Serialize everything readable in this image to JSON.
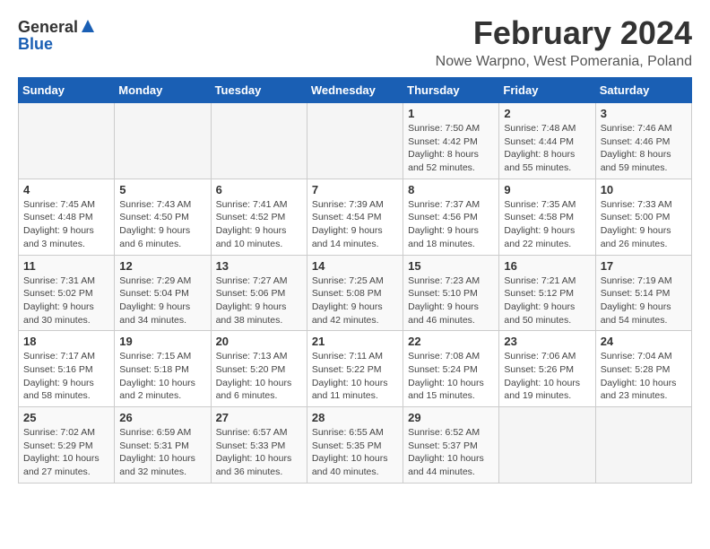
{
  "logo": {
    "general": "General",
    "blue": "Blue"
  },
  "title": "February 2024",
  "subtitle": "Nowe Warpno, West Pomerania, Poland",
  "days_of_week": [
    "Sunday",
    "Monday",
    "Tuesday",
    "Wednesday",
    "Thursday",
    "Friday",
    "Saturday"
  ],
  "weeks": [
    [
      {
        "day": "",
        "info": ""
      },
      {
        "day": "",
        "info": ""
      },
      {
        "day": "",
        "info": ""
      },
      {
        "day": "",
        "info": ""
      },
      {
        "day": "1",
        "info": "Sunrise: 7:50 AM\nSunset: 4:42 PM\nDaylight: 8 hours\nand 52 minutes."
      },
      {
        "day": "2",
        "info": "Sunrise: 7:48 AM\nSunset: 4:44 PM\nDaylight: 8 hours\nand 55 minutes."
      },
      {
        "day": "3",
        "info": "Sunrise: 7:46 AM\nSunset: 4:46 PM\nDaylight: 8 hours\nand 59 minutes."
      }
    ],
    [
      {
        "day": "4",
        "info": "Sunrise: 7:45 AM\nSunset: 4:48 PM\nDaylight: 9 hours\nand 3 minutes."
      },
      {
        "day": "5",
        "info": "Sunrise: 7:43 AM\nSunset: 4:50 PM\nDaylight: 9 hours\nand 6 minutes."
      },
      {
        "day": "6",
        "info": "Sunrise: 7:41 AM\nSunset: 4:52 PM\nDaylight: 9 hours\nand 10 minutes."
      },
      {
        "day": "7",
        "info": "Sunrise: 7:39 AM\nSunset: 4:54 PM\nDaylight: 9 hours\nand 14 minutes."
      },
      {
        "day": "8",
        "info": "Sunrise: 7:37 AM\nSunset: 4:56 PM\nDaylight: 9 hours\nand 18 minutes."
      },
      {
        "day": "9",
        "info": "Sunrise: 7:35 AM\nSunset: 4:58 PM\nDaylight: 9 hours\nand 22 minutes."
      },
      {
        "day": "10",
        "info": "Sunrise: 7:33 AM\nSunset: 5:00 PM\nDaylight: 9 hours\nand 26 minutes."
      }
    ],
    [
      {
        "day": "11",
        "info": "Sunrise: 7:31 AM\nSunset: 5:02 PM\nDaylight: 9 hours\nand 30 minutes."
      },
      {
        "day": "12",
        "info": "Sunrise: 7:29 AM\nSunset: 5:04 PM\nDaylight: 9 hours\nand 34 minutes."
      },
      {
        "day": "13",
        "info": "Sunrise: 7:27 AM\nSunset: 5:06 PM\nDaylight: 9 hours\nand 38 minutes."
      },
      {
        "day": "14",
        "info": "Sunrise: 7:25 AM\nSunset: 5:08 PM\nDaylight: 9 hours\nand 42 minutes."
      },
      {
        "day": "15",
        "info": "Sunrise: 7:23 AM\nSunset: 5:10 PM\nDaylight: 9 hours\nand 46 minutes."
      },
      {
        "day": "16",
        "info": "Sunrise: 7:21 AM\nSunset: 5:12 PM\nDaylight: 9 hours\nand 50 minutes."
      },
      {
        "day": "17",
        "info": "Sunrise: 7:19 AM\nSunset: 5:14 PM\nDaylight: 9 hours\nand 54 minutes."
      }
    ],
    [
      {
        "day": "18",
        "info": "Sunrise: 7:17 AM\nSunset: 5:16 PM\nDaylight: 9 hours\nand 58 minutes."
      },
      {
        "day": "19",
        "info": "Sunrise: 7:15 AM\nSunset: 5:18 PM\nDaylight: 10 hours\nand 2 minutes."
      },
      {
        "day": "20",
        "info": "Sunrise: 7:13 AM\nSunset: 5:20 PM\nDaylight: 10 hours\nand 6 minutes."
      },
      {
        "day": "21",
        "info": "Sunrise: 7:11 AM\nSunset: 5:22 PM\nDaylight: 10 hours\nand 11 minutes."
      },
      {
        "day": "22",
        "info": "Sunrise: 7:08 AM\nSunset: 5:24 PM\nDaylight: 10 hours\nand 15 minutes."
      },
      {
        "day": "23",
        "info": "Sunrise: 7:06 AM\nSunset: 5:26 PM\nDaylight: 10 hours\nand 19 minutes."
      },
      {
        "day": "24",
        "info": "Sunrise: 7:04 AM\nSunset: 5:28 PM\nDaylight: 10 hours\nand 23 minutes."
      }
    ],
    [
      {
        "day": "25",
        "info": "Sunrise: 7:02 AM\nSunset: 5:29 PM\nDaylight: 10 hours\nand 27 minutes."
      },
      {
        "day": "26",
        "info": "Sunrise: 6:59 AM\nSunset: 5:31 PM\nDaylight: 10 hours\nand 32 minutes."
      },
      {
        "day": "27",
        "info": "Sunrise: 6:57 AM\nSunset: 5:33 PM\nDaylight: 10 hours\nand 36 minutes."
      },
      {
        "day": "28",
        "info": "Sunrise: 6:55 AM\nSunset: 5:35 PM\nDaylight: 10 hours\nand 40 minutes."
      },
      {
        "day": "29",
        "info": "Sunrise: 6:52 AM\nSunset: 5:37 PM\nDaylight: 10 hours\nand 44 minutes."
      },
      {
        "day": "",
        "info": ""
      },
      {
        "day": "",
        "info": ""
      }
    ]
  ]
}
